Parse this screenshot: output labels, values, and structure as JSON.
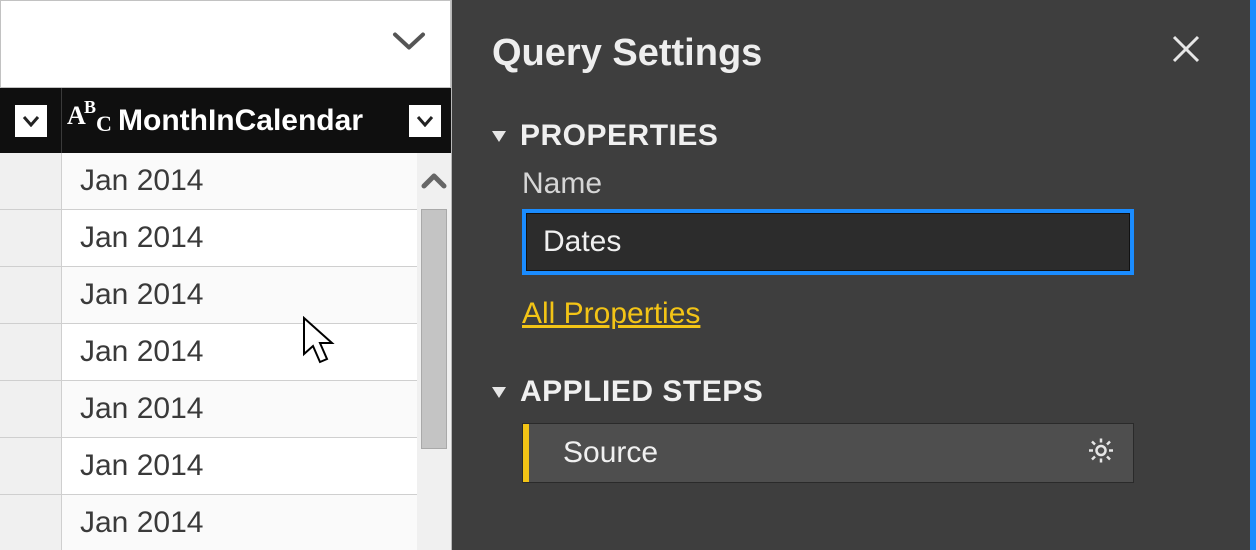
{
  "left": {
    "column_header": "MonthInCalendar",
    "rows": [
      "Jan 2014",
      "Jan 2014",
      "Jan 2014",
      "Jan 2014",
      "Jan 2014",
      "Jan 2014",
      "Jan 2014"
    ]
  },
  "querySettings": {
    "title": "Query Settings",
    "properties": {
      "heading": "PROPERTIES",
      "name_label": "Name",
      "name_value": "Dates",
      "all_properties": "All Properties"
    },
    "appliedSteps": {
      "heading": "APPLIED STEPS",
      "steps": [
        {
          "label": "Source",
          "selected": true
        }
      ]
    }
  }
}
